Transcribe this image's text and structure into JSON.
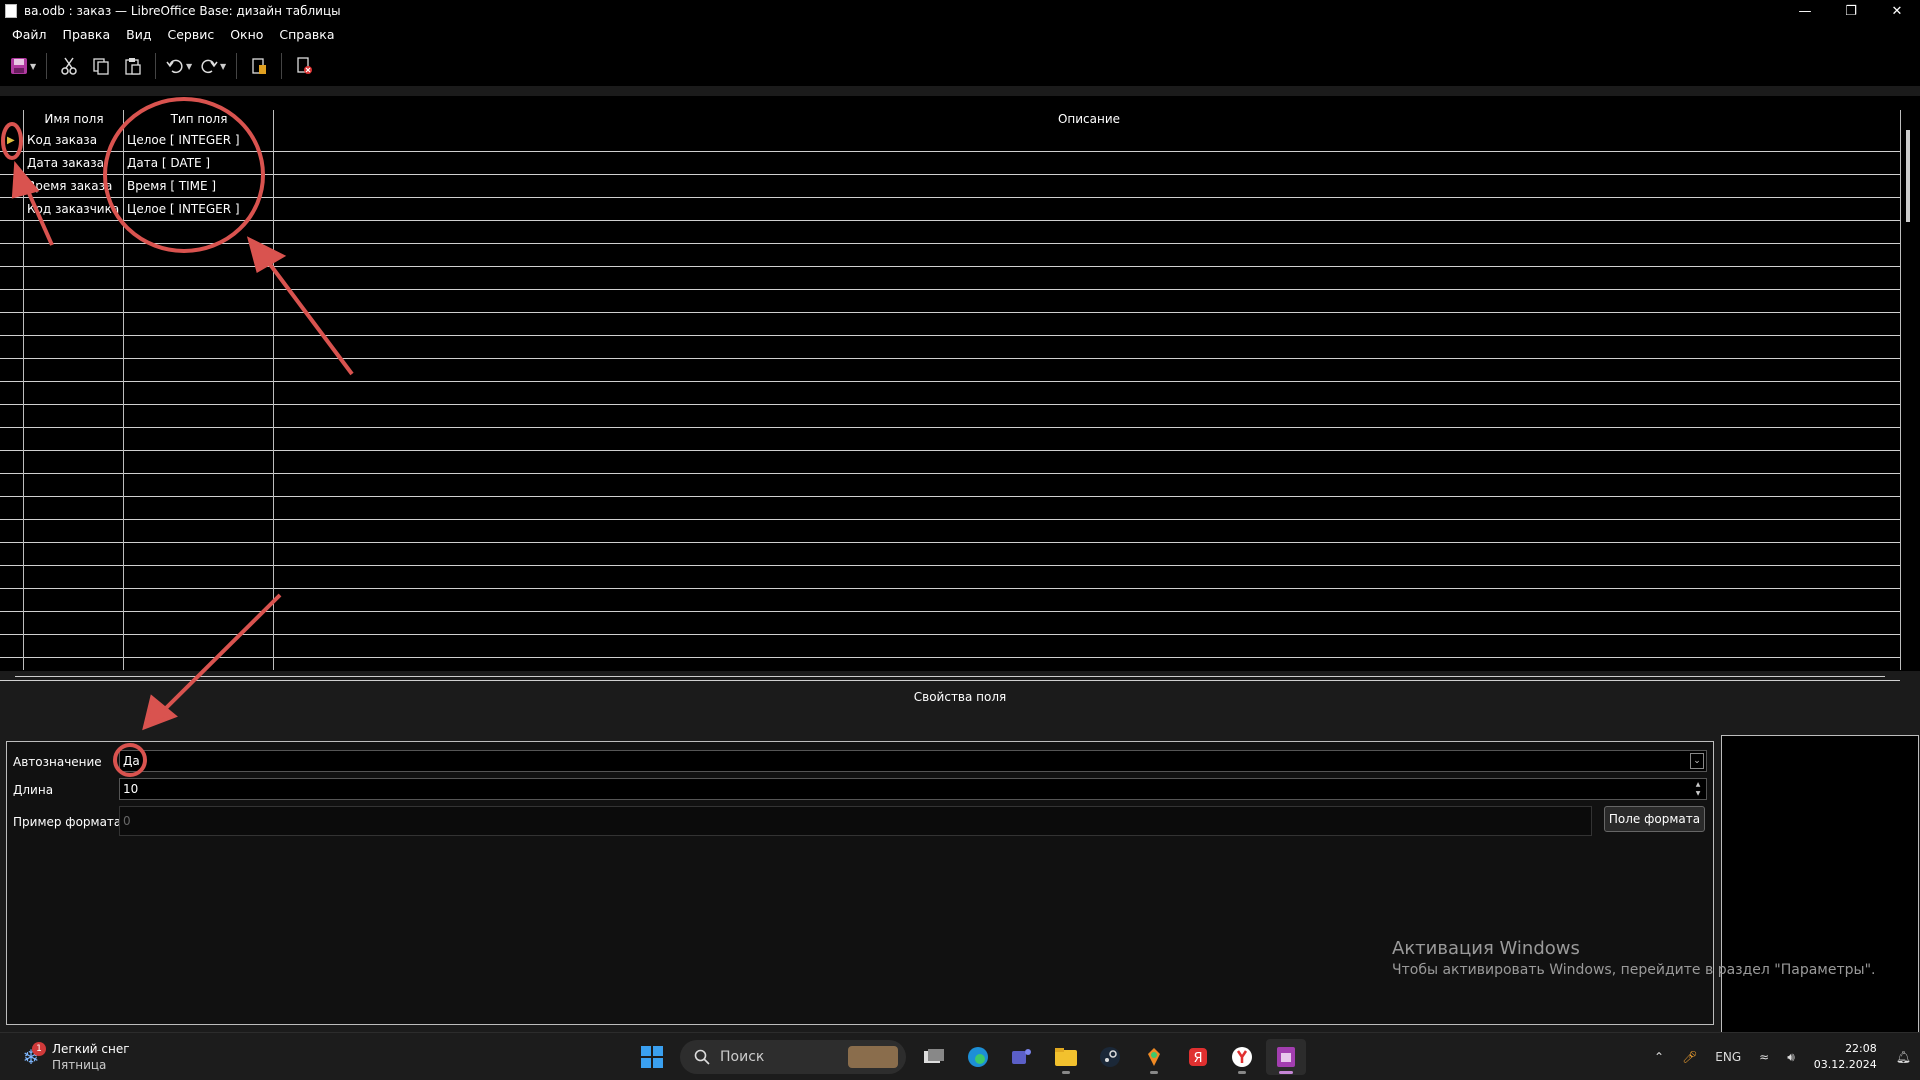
{
  "window": {
    "title": "ва.odb : заказ — LibreOffice Base: дизайн таблицы",
    "controls": [
      "minimize-icon",
      "restore-icon",
      "close-icon"
    ]
  },
  "menu": [
    "Файл",
    "Правка",
    "Вид",
    "Сервис",
    "Окно",
    "Справка"
  ],
  "toolbar": {
    "icons": [
      "save-icon",
      "cut-icon",
      "copy-icon",
      "paste-icon",
      "undo-icon",
      "redo-icon",
      "index-design-icon",
      "primary-key-icon"
    ]
  },
  "grid": {
    "headers": {
      "name": "Имя поля",
      "type": "Тип поля",
      "description": "Описание"
    },
    "rows": [
      {
        "name": "Код заказа",
        "type": "Целое [ INTEGER ]",
        "description": "",
        "primary_key": true
      },
      {
        "name": "Дата заказа",
        "type": "Дата [ DATE ]",
        "description": ""
      },
      {
        "name": "Время заказа",
        "type": "Время [ TIME ]",
        "description": ""
      },
      {
        "name": "Код заказчика",
        "type": "Целое [ INTEGER ]",
        "description": ""
      }
    ],
    "empty_rows": 20
  },
  "properties": {
    "title": "Свойства поля",
    "autovalue_label": "Автозначение",
    "autovalue_value": "Да",
    "length_label": "Длина",
    "length_value": "10",
    "format_label": "Пример формата",
    "format_value": "0",
    "format_button": "Поле формата"
  },
  "activation": {
    "title": "Активация Windows",
    "text": "Чтобы активировать Windows, перейдите в раздел \"Параметры\"."
  },
  "taskbar": {
    "weather_text": "Легкий снег",
    "weather_day": "Пятница",
    "weather_badge": "1",
    "search_placeholder": "Поиск",
    "language": "ENG",
    "time": "22:08",
    "date": "03.12.2024"
  },
  "colors": {
    "annotation": "#d9534f",
    "background": "#1b1b1b",
    "grid_bg": "#000000"
  }
}
